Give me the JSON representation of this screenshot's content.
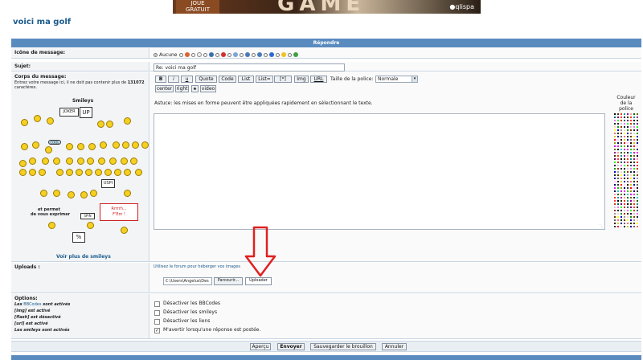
{
  "banner": {
    "gratuit": "JOUE\nGRATUIT",
    "game_text": "GAME",
    "brand": "●qlispa"
  },
  "page_title": "voici ma golf",
  "header": {
    "title": "Répondre"
  },
  "message_icon": {
    "label": "Icône de message:",
    "none_label": "Aucune"
  },
  "subject": {
    "label": "Sujet:",
    "value": "Re: voici ma golf"
  },
  "body": {
    "label": "Corps du message:",
    "note": "Entrez votre message ici, il ne doit pas contenir plus de",
    "limit": "131072",
    "note_suffix": "caractères.",
    "smileys_title": "Smileys",
    "more_smileys": "Voir plus de smileys",
    "sign_joker": "JOKER",
    "sign_up": "UP",
    "sign_cool": "COOL",
    "sign_uspi": "USPI",
    "express_text": "et permet\nde vous exprimer",
    "sign_rrrah": "Rrrrrh...\nF'Em !",
    "sign_pc": "%",
    "sign_spin": "SPIN"
  },
  "toolbar": {
    "bold": "B",
    "italic": "i",
    "underline": "u",
    "quote": "Quote",
    "code": "Code",
    "list": "List",
    "list_eq": "List=",
    "star": "[*]",
    "img": "Img",
    "url": "URL",
    "font_size_label": "Taille de la police:",
    "font_size_value": "Normale",
    "center": "center",
    "right": "right",
    "s": "s",
    "video": "video"
  },
  "hint": "Astuce: les mises en forme peuvent être appliquées rapidement en sélectionnant le texte.",
  "color_label": "Couleur\nde la\npolice",
  "uploads": {
    "label": "Uploads :",
    "link": "Utilisez le forum pour héberger vos images",
    "file_value": "C:\\Users\\Angelus\\Des",
    "browse": "Parcourir...",
    "upload": "Uploader"
  },
  "options": {
    "label": "Options:",
    "notes": [
      {
        "pre": "Les ",
        "link": "BBCodes",
        "post": " sont activés"
      },
      {
        "pre": "[img] est ",
        "link": "",
        "post": "activé"
      },
      {
        "pre": "[flash] est ",
        "link": "",
        "post": "désactivé"
      },
      {
        "pre": "[url] est ",
        "link": "",
        "post": "activé"
      },
      {
        "pre": "Les smileys sont ",
        "link": "",
        "post": "activés"
      }
    ],
    "checks": [
      {
        "label": "Désactiver les BBCodes",
        "checked": false
      },
      {
        "label": "Désactiver les smileys",
        "checked": false
      },
      {
        "label": "Désactiver les liens",
        "checked": false
      },
      {
        "label": "M'avertir lorsqu'une réponse est postée.",
        "checked": true
      }
    ]
  },
  "actions": {
    "preview": "Aperçu",
    "send": "Envoyer",
    "draft": "Sauvegarder le brouillon",
    "cancel": "Annuler"
  },
  "colors": {
    "accent": "#5a8bbf",
    "link": "#1a5b8c",
    "arrow": "#e02020"
  }
}
